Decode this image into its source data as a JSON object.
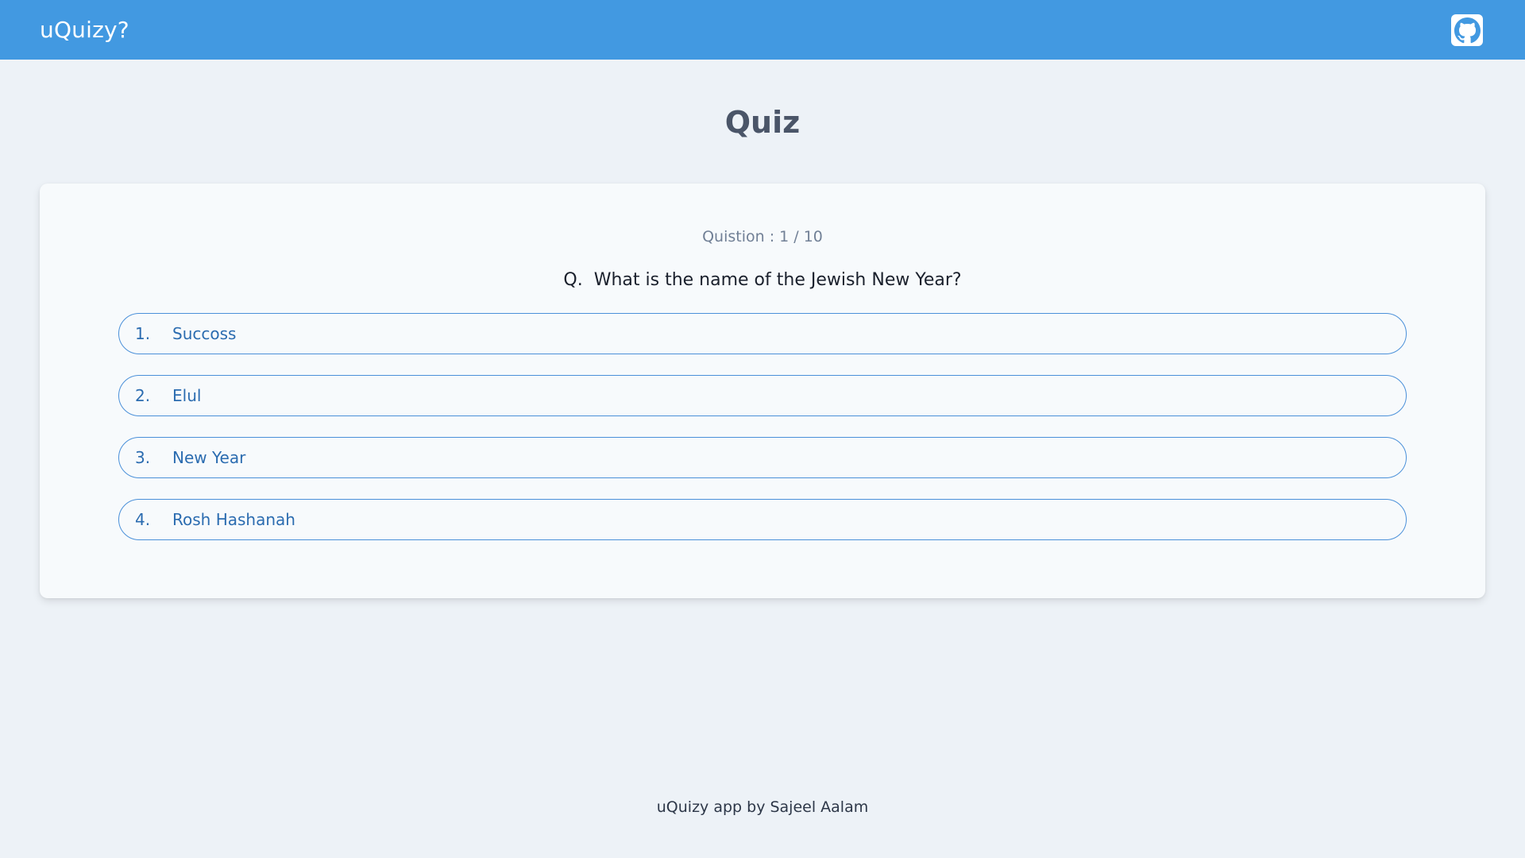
{
  "header": {
    "brand": "uQuizy?",
    "github_icon": "github-icon",
    "background_color": "#4299e1"
  },
  "page": {
    "title": "Quiz"
  },
  "quiz": {
    "counter": "Quistion : 1 / 10",
    "question_prefix": "Q.",
    "question_text": "What is the name of the Jewish New Year?",
    "options": [
      {
        "number": "1.",
        "text": "Succoss"
      },
      {
        "number": "2.",
        "text": "Elul"
      },
      {
        "number": "3.",
        "text": "New Year"
      },
      {
        "number": "4.",
        "text": "Rosh Hashanah"
      }
    ]
  },
  "footer": {
    "text": "uQuizy app by Sajeel Aalam"
  }
}
